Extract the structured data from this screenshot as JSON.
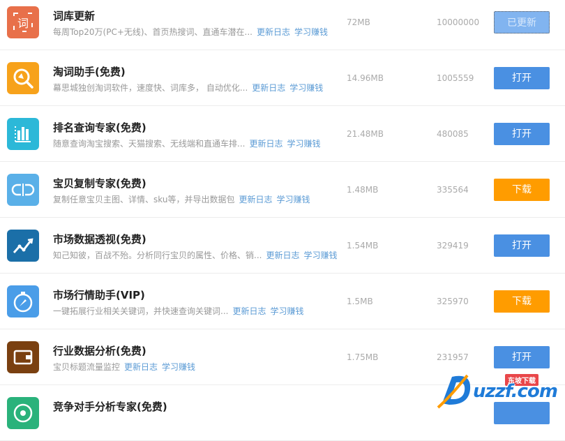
{
  "apps": [
    {
      "title": "词库更新",
      "description": "每周Top20万(PC+无线)、首页热搜词、直通车潜在...",
      "changelog_label": "更新日志",
      "earn_label": "学习赚钱",
      "size": "72MB",
      "count": "10000000",
      "button_label": "已更新",
      "button_style": "done",
      "icon": "dictionary-icon",
      "icon_color": "#e8704a"
    },
    {
      "title": "淘词助手(免费)",
      "description": "幕思城独创淘词软件，速度快、词库多， 自动优化...",
      "changelog_label": "更新日志",
      "earn_label": "学习赚钱",
      "size": "14.96MB",
      "count": "1005559",
      "button_label": "打开",
      "button_style": "open",
      "icon": "search-icon",
      "icon_color": "#f7a21b"
    },
    {
      "title": "排名查询专家(免费)",
      "description": "随意查询淘宝搜索、天猫搜索、无线端和直通车排...",
      "changelog_label": "更新日志",
      "earn_label": "学习赚钱",
      "size": "21.48MB",
      "count": "480085",
      "button_label": "打开",
      "button_style": "open",
      "icon": "bar-chart-icon",
      "icon_color": "#2cb8d8"
    },
    {
      "title": "宝贝复制专家(免费)",
      "description": "复制任意宝贝主图、详情、sku等，并导出数据包",
      "changelog_label": "更新日志",
      "earn_label": "学习赚钱",
      "size": "1.48MB",
      "count": "335564",
      "button_label": "下载",
      "button_style": "download",
      "icon": "copy-link-icon",
      "icon_color": "#5ab0e8"
    },
    {
      "title": "市场数据透视(免费)",
      "description": "知己知彼，百战不殆。分析同行宝贝的属性、价格、销...",
      "changelog_label": "更新日志",
      "earn_label": "学习赚钱",
      "size": "1.54MB",
      "count": "329419",
      "button_label": "打开",
      "button_style": "open",
      "icon": "trend-line-icon",
      "icon_color": "#1b6fa8"
    },
    {
      "title": "市场行情助手(VIP)",
      "description": "一键拓展行业相关关键词，并快速查询关键词...",
      "changelog_label": "更新日志",
      "earn_label": "学习赚钱",
      "size": "1.5MB",
      "count": "325970",
      "button_label": "下载",
      "button_style": "download",
      "icon": "compass-icon",
      "icon_color": "#4a9de8"
    },
    {
      "title": "行业数据分析(免费)",
      "description": "宝贝标题流量监控",
      "changelog_label": "更新日志",
      "earn_label": "学习赚钱",
      "size": "1.75MB",
      "count": "231957",
      "button_label": "打开",
      "button_style": "open",
      "icon": "wallet-icon",
      "icon_color": "#7a4010"
    },
    {
      "title": "竞争对手分析专家(免费)",
      "description": "",
      "changelog_label": "",
      "earn_label": "",
      "size": "",
      "count": "",
      "button_label": "",
      "button_style": "open",
      "icon": "radar-icon",
      "icon_color": "#2ab27b"
    }
  ],
  "watermark": {
    "text": "uzzf.com",
    "badge": "东坡下载"
  }
}
